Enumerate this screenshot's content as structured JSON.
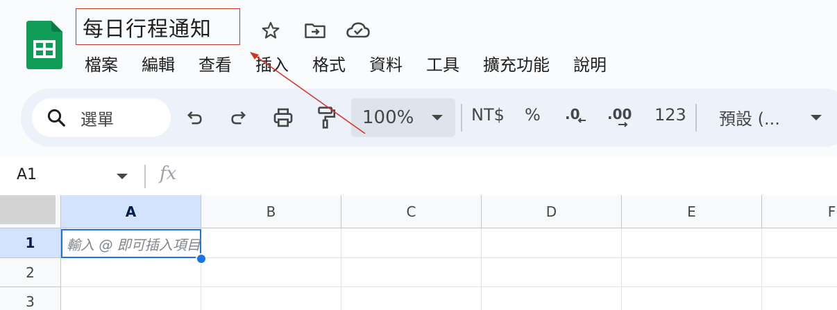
{
  "document": {
    "title": "每日行程通知"
  },
  "header_icons": [
    "star-icon",
    "move-to-folder-icon",
    "cloud-saved-icon"
  ],
  "menu": [
    "檔案",
    "編輯",
    "查看",
    "插入",
    "格式",
    "資料",
    "工具",
    "擴充功能",
    "說明"
  ],
  "toolbar": {
    "search_label": "選單",
    "zoom": "100%",
    "currency": "NT$",
    "percent": "%",
    "decrease_decimal": ".0",
    "increase_decimal": ".00",
    "number_format": "123",
    "font": "預設 (..."
  },
  "formula_bar": {
    "cell_ref": "A1",
    "fx": "fx"
  },
  "grid": {
    "columns": [
      "A",
      "B",
      "C",
      "D",
      "E",
      "F"
    ],
    "rows": [
      "1",
      "2",
      "3"
    ],
    "active_cell_placeholder": "輸入 @ 即可插入項目"
  },
  "colors": {
    "accent": "#1a73e8",
    "sheets_green": "#0f9d58",
    "annotation_red": "#d93025"
  }
}
